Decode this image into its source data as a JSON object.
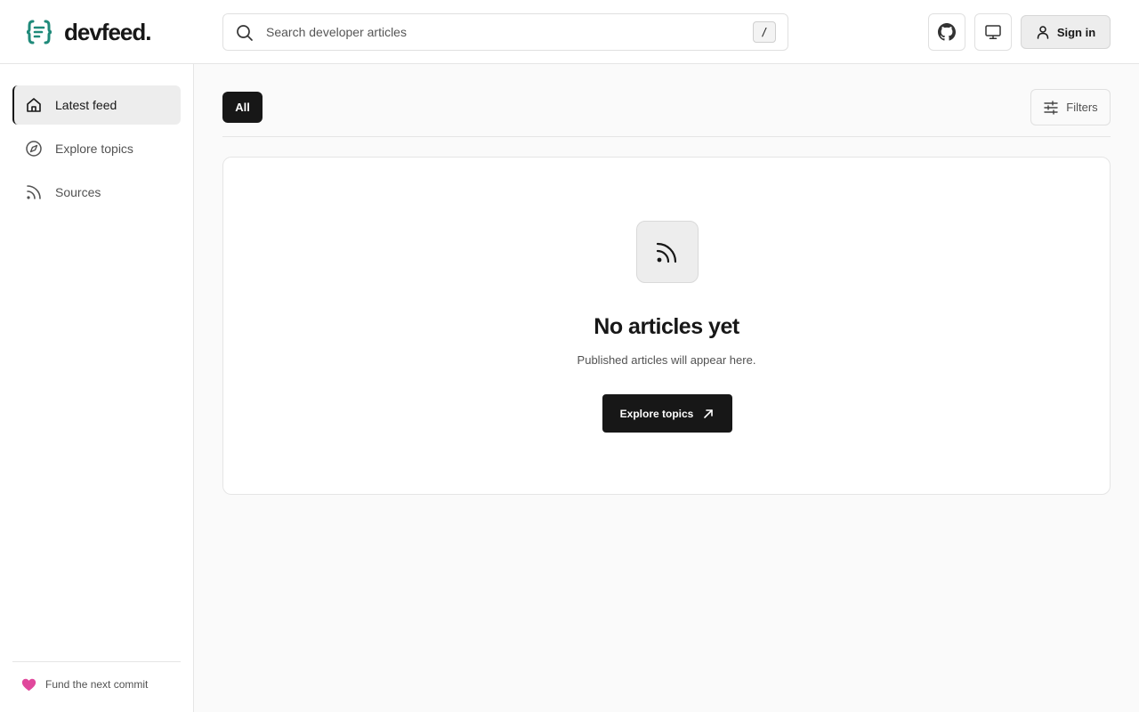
{
  "brand": {
    "name": "devfeed.",
    "accent": "#1f8a7a"
  },
  "search": {
    "placeholder": "Search developer articles",
    "value": "",
    "shortcut": "/"
  },
  "header": {
    "github_icon": "github-icon",
    "display_icon": "monitor-icon",
    "signin_label": "Sign in"
  },
  "sidebar": {
    "items": [
      {
        "label": "Latest feed",
        "icon": "home-icon",
        "active": true
      },
      {
        "label": "Explore topics",
        "icon": "compass-icon",
        "active": false
      },
      {
        "label": "Sources",
        "icon": "rss-icon",
        "active": false
      }
    ],
    "footer": {
      "label": "Fund the next commit",
      "icon": "heart-icon",
      "color": "#e0489c"
    }
  },
  "main": {
    "filter_pill": "All",
    "filters_label": "Filters",
    "empty": {
      "title": "No articles yet",
      "subtitle": "Published articles will appear here.",
      "cta_label": "Explore topics"
    }
  }
}
